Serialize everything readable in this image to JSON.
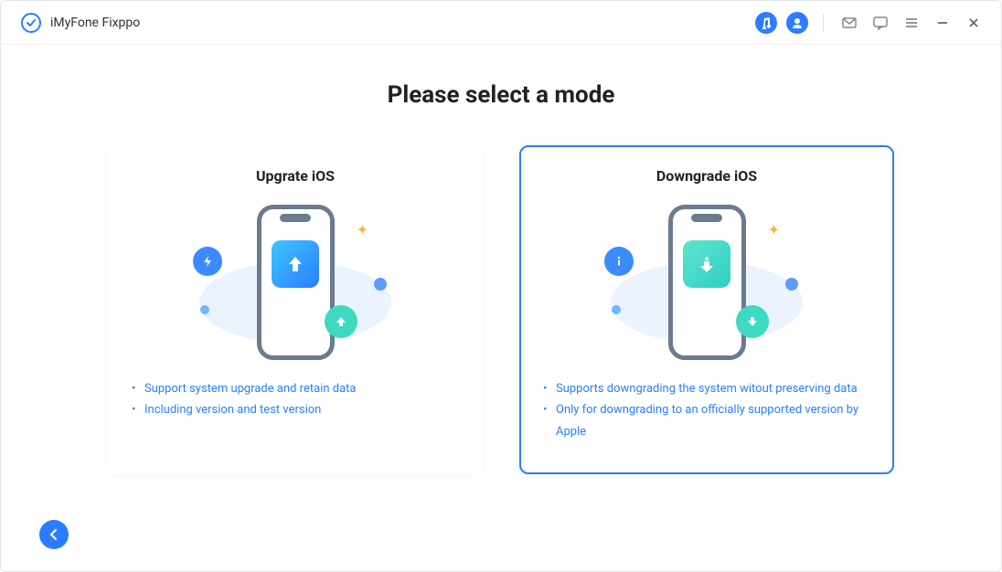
{
  "header": {
    "app_title": "iMyFone Fixppo"
  },
  "main": {
    "page_title": "Please select a mode",
    "cards": [
      {
        "title": "Upgrate iOS",
        "selected": false,
        "direction": "up",
        "bullets": [
          "Support system upgrade and retain data",
          "Including version and test version"
        ]
      },
      {
        "title": "Downgrade iOS",
        "selected": true,
        "direction": "down",
        "bullets": [
          "Supports downgrading the system witout preserving data",
          "Only for downgrading to an officially supported version by Apple"
        ]
      }
    ]
  }
}
